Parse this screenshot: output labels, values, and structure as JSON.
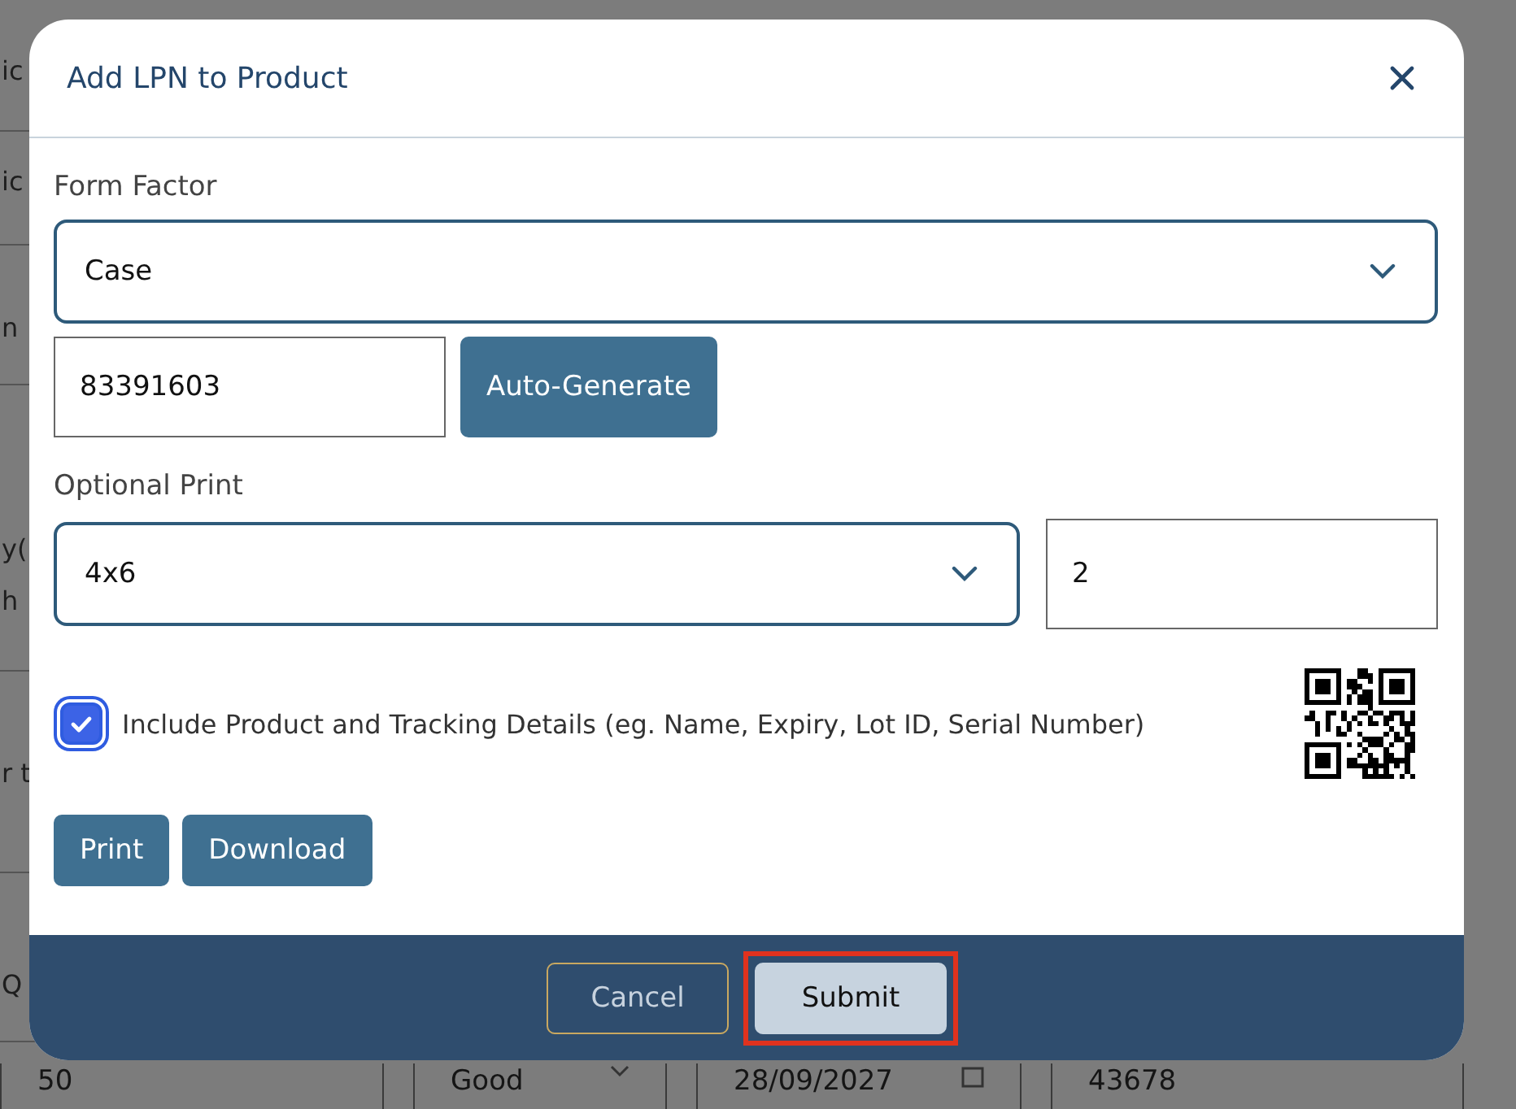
{
  "background": {
    "fragments": [
      "ic",
      "ic",
      "n",
      "y(",
      "h",
      "r t",
      "Q"
    ],
    "fields": [
      {
        "value": "50",
        "kind": "text"
      },
      {
        "value": "Good",
        "kind": "select"
      },
      {
        "value": "28/09/2027",
        "kind": "date"
      },
      {
        "value": "43678",
        "kind": "text"
      }
    ]
  },
  "dialog": {
    "title": "Add LPN to Product",
    "form_factor": {
      "label": "Form Factor",
      "value": "Case"
    },
    "lpn": {
      "value": "83391603"
    },
    "auto_generate": "Auto-Generate",
    "optional_print": {
      "label": "Optional Print",
      "value": "4x6"
    },
    "copies": {
      "value": "2"
    },
    "include_details": {
      "label": "Include Product and Tracking Details (eg. Name, Expiry, Lot ID, Serial Number)",
      "checked": true
    },
    "actions": [
      "Print",
      "Download"
    ],
    "footer": [
      {
        "label": "Cancel",
        "kind": "secondary",
        "outlined": false
      },
      {
        "label": "Submit",
        "kind": "primary",
        "outlined": true
      }
    ]
  }
}
